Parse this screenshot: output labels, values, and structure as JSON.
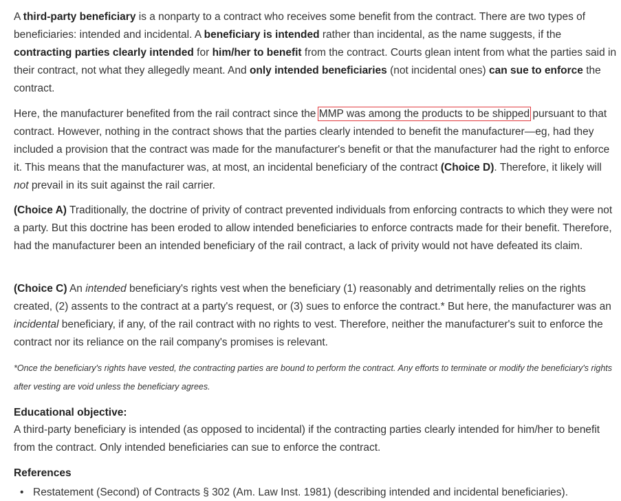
{
  "p1": {
    "a": "A ",
    "b": "third-party beneficiary",
    "c": " is a nonparty to a contract who receives some benefit from the contract.  There are two types of beneficiaries: intended and incidental.  A ",
    "d": "beneficiary is intended",
    "e": " rather than incidental, as the name suggests, if the ",
    "f": "contracting parties clearly intended",
    "g": " for ",
    "h": "him/her to benefit",
    "i": " from the contract.  Courts glean intent from what the parties said in their contract, not what they allegedly meant.  And ",
    "j": "only intended beneficiaries",
    "k": " (not incidental ones) ",
    "l": "can sue to enforce",
    "m": " the contract."
  },
  "p2": {
    "a": "Here, the manufacturer benefited from the rail contract since the ",
    "highlight": "MMP was among the products to be shipped",
    "b": " pursuant to that contract.  However, nothing in the contract shows that the parties clearly intended to benefit the manufacturer—eg, had they included a provision that the contract was made for the manufacturer's benefit or that the manufacturer had the right to enforce it.  This means that the manufacturer was, at most, an incidental beneficiary of the contract ",
    "choice": "(Choice D)",
    "c": ".  Therefore, it likely will ",
    "not": "not",
    "d": " prevail in its suit against the rail carrier."
  },
  "p3": {
    "choice": "(Choice A)",
    "text": "  Traditionally, the doctrine of privity of contract prevented individuals from enforcing contracts to which they were not a party.  But this doctrine has been eroded to allow intended beneficiaries to enforce contracts made for their benefit.  Therefore, had the manufacturer been an intended beneficiary of the rail contract, a lack of privity would not have defeated its claim."
  },
  "p4": {
    "choice": "(Choice C)",
    "a": "  An ",
    "intended": "intended",
    "b": " beneficiary's rights vest when the beneficiary (1) reasonably and detrimentally relies on the rights created, (2) assents to the contract at a party's request, or (3) sues to enforce the contract.*  But here, the manufacturer was an ",
    "incidental": "incidental",
    "c": " beneficiary, if any, of the rail contract with no rights to vest.  Therefore, neither the manufacturer's suit to enforce the contract nor its reliance on the rail company's promises is relevant."
  },
  "footnote": "*Once the beneficiary's rights have vested, the contracting parties are bound to perform the contract.  Any efforts to terminate or modify the beneficiary's rights after vesting are void unless the beneficiary agrees.",
  "objective": {
    "heading": "Educational objective:",
    "text": "A third-party beneficiary is intended (as opposed to incidental) if the contracting parties clearly intended for him/her to benefit from the contract.  Only intended beneficiaries can sue to enforce the contract."
  },
  "references": {
    "heading": "References",
    "bullet": "•",
    "items": [
      "Restatement (Second) of Contracts § 302 (Am. Law Inst. 1981) (describing intended and incidental beneficiaries)."
    ]
  }
}
